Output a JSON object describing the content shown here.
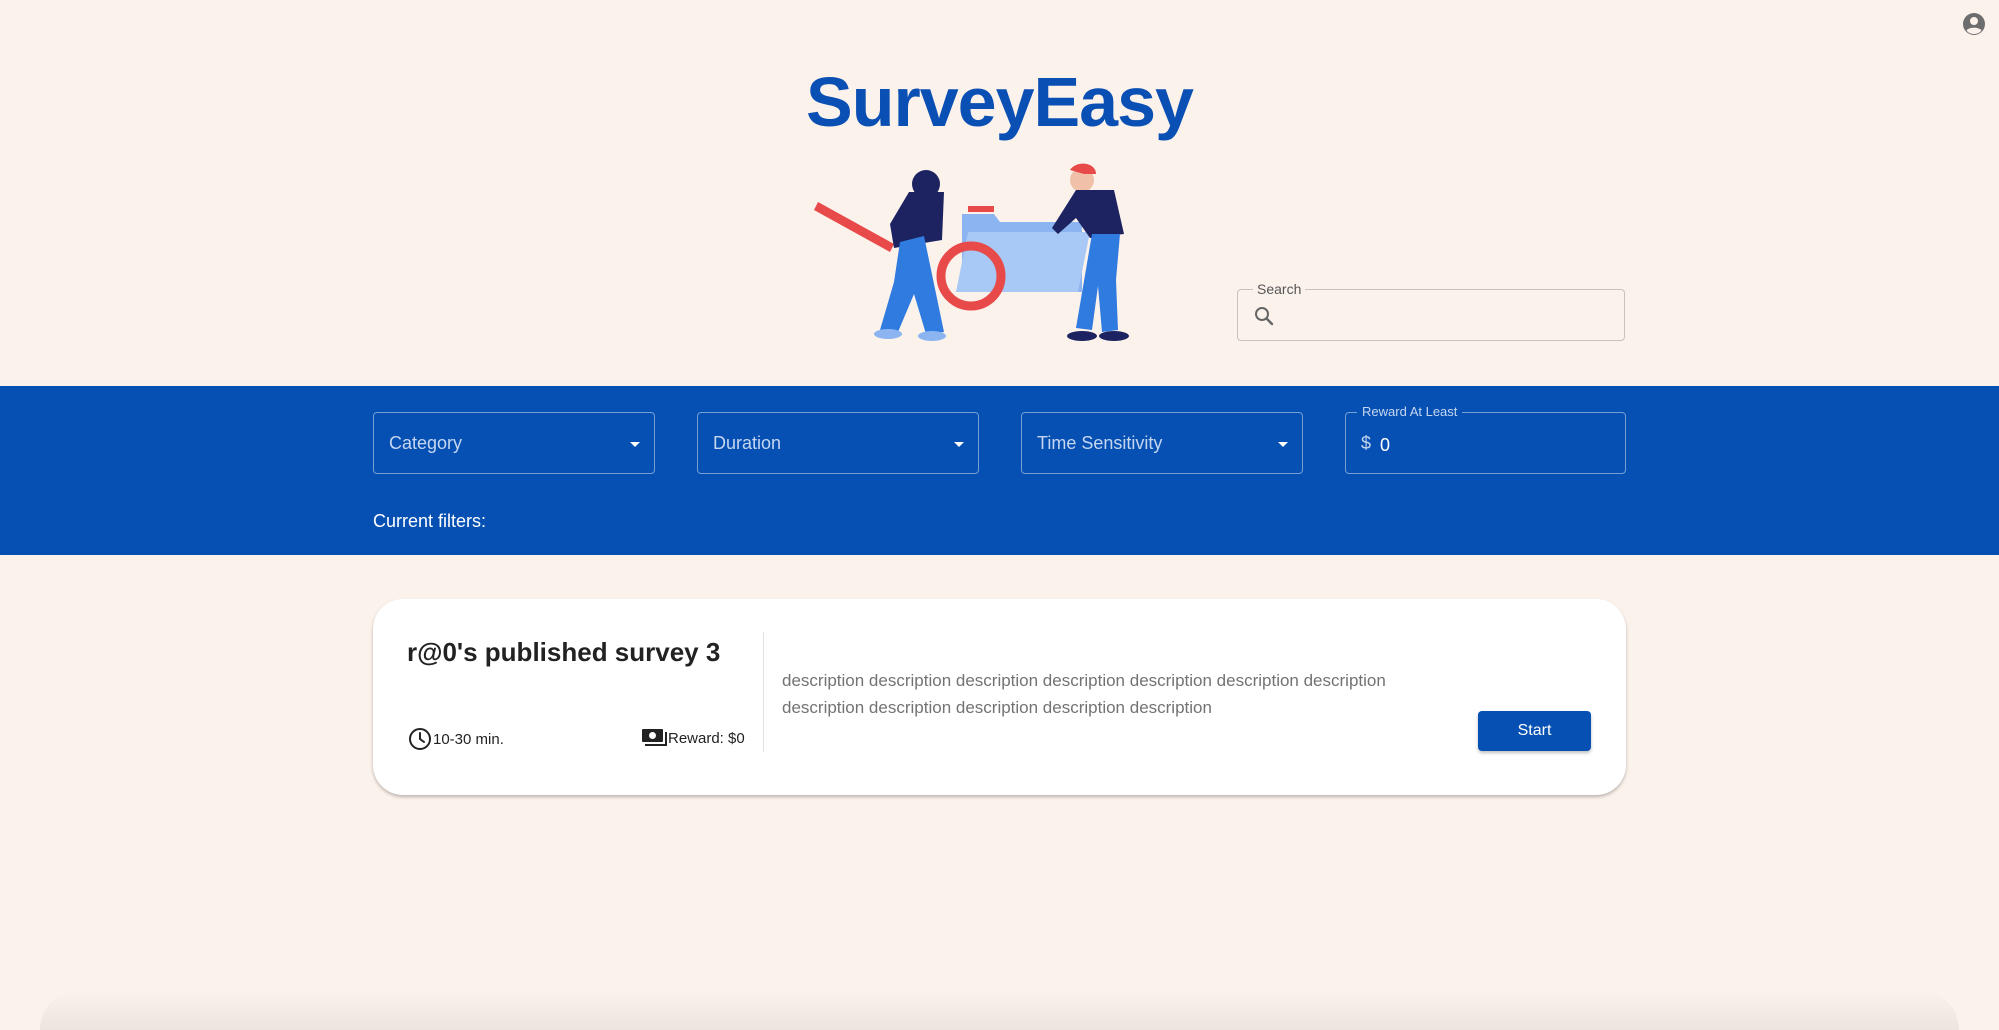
{
  "header": {
    "brand": "SurveyEasy",
    "account_icon": "account-circle-icon",
    "hero_icon": "survey-illustration"
  },
  "search": {
    "label": "Search",
    "value": "",
    "placeholder": "",
    "icon": "search-icon"
  },
  "filters": {
    "category_label": "Category",
    "duration_label": "Duration",
    "time_sensitivity_label": "Time Sensitivity",
    "reward_label": "Reward At Least",
    "reward_prefix": "$",
    "reward_value": "0",
    "current_filters_label": "Current filters:"
  },
  "surveys": [
    {
      "title": "r@0's published survey 3",
      "duration": "10-30 min.",
      "reward": "Reward: $0",
      "description": "description description description description description description description description description description description description",
      "start_label": "Start"
    }
  ],
  "colors": {
    "background": "#fcf2ec",
    "brand": "#0a4fb3",
    "filter_band": "#0550b2"
  }
}
